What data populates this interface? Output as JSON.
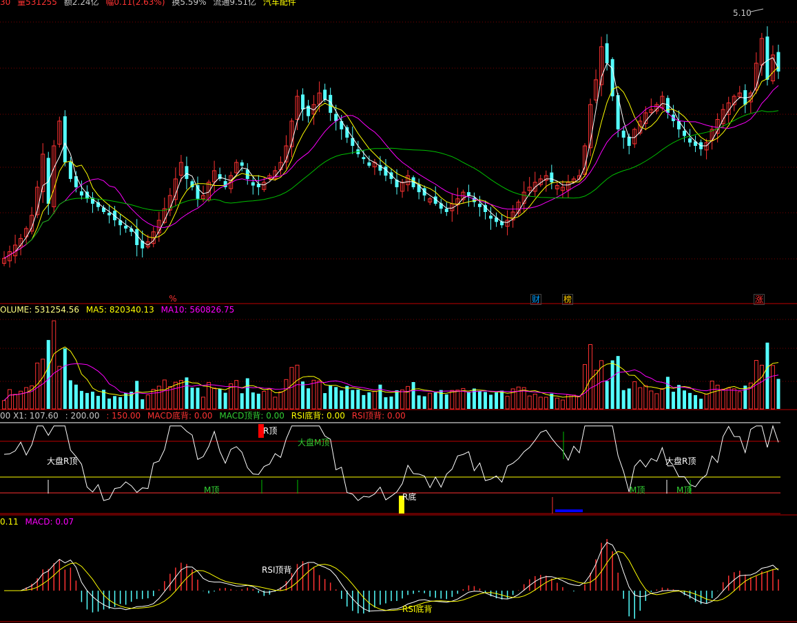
{
  "header": {
    "items": [
      {
        "text": "30",
        "color": "#ff3232"
      },
      {
        "text": "量531255",
        "color": "#ff3232"
      },
      {
        "text": "额2.24亿",
        "color": "#c8c8c8"
      },
      {
        "text": "幅0.11(2.63%)",
        "color": "#ff3232"
      },
      {
        "text": "换5.59%",
        "color": "#c8c8c8"
      },
      {
        "text": "流通9.51亿",
        "color": "#c8c8c8"
      },
      {
        "text": "汽车配件",
        "color": "#ffff00"
      }
    ]
  },
  "price_panel": {
    "high_label": "5.10",
    "events": [
      {
        "text": "%",
        "color": "#ff3232",
        "border": "#000"
      },
      {
        "text": "财",
        "color": "#00a0ff",
        "border": "#444"
      },
      {
        "text": "榜",
        "color": "#ffcc00",
        "border": "#444"
      },
      {
        "text": "涨",
        "color": "#ff3232",
        "border": "#444"
      }
    ]
  },
  "volume_panel": {
    "label_volume": "OLUME: 531254.56",
    "label_ma5": "MA5: 820340.13",
    "label_ma10": "MA10: 560826.75"
  },
  "signal_panel": {
    "label_x": "00  X1: 107.60",
    "label_200": ": 200.00",
    "label_150": ": 150.00",
    "label_macd_bottom": "MACD底背: 0.00",
    "label_macd_top": "MACD顶背: 0.00",
    "label_rsi_bottom": "RSI底背: 0.00",
    "label_rsi_top": "RSI顶背: 0.00",
    "marks": [
      {
        "text": "R顶",
        "color": "#ffffff"
      },
      {
        "text": "大盘M顶",
        "color": "#32cd32"
      },
      {
        "text": "大盘R顶",
        "color": "#ffffff"
      },
      {
        "text": "大盘R顶",
        "color": "#ffffff"
      },
      {
        "text": "M顶",
        "color": "#32cd32"
      },
      {
        "text": "M顶",
        "color": "#32cd32"
      },
      {
        "text": "M顶",
        "color": "#32cd32"
      },
      {
        "text": "R底",
        "color": "#ffffff"
      }
    ]
  },
  "macd_panel": {
    "label_dif": "0.11",
    "label_macd": "MACD: 0.07",
    "mark_top": "RSI顶背",
    "mark_bottom": "RSI底背"
  },
  "colors": {
    "up": "#ff3232",
    "down": "#54ffff",
    "ma_white": "#ffffff",
    "ma_yellow": "#ffff00",
    "ma_magenta": "#ff00ff",
    "ma_green": "#00c000",
    "grid": "#800000",
    "separator": "#c00000"
  },
  "chart_data": {
    "type": "candlestick",
    "closes": [
      3.62,
      3.66,
      3.7,
      3.74,
      3.8,
      3.88,
      4.05,
      4.25,
      3.95,
      4.3,
      4.45,
      4.2,
      4.1,
      4.05,
      4.0,
      3.98,
      3.95,
      3.93,
      3.9,
      3.88,
      3.85,
      3.82,
      3.8,
      3.78,
      3.7,
      3.68,
      3.72,
      3.78,
      3.85,
      3.92,
      4.0,
      4.1,
      4.2,
      4.1,
      4.05,
      3.98,
      4.0,
      4.08,
      4.15,
      4.1,
      4.05,
      4.12,
      4.2,
      4.18,
      4.1,
      4.06,
      4.05,
      4.08,
      4.12,
      4.15,
      4.2,
      4.3,
      4.45,
      4.6,
      4.52,
      4.48,
      4.55,
      4.62,
      4.58,
      4.5,
      4.45,
      4.4,
      4.35,
      4.3,
      4.25,
      4.22,
      4.18,
      4.2,
      4.15,
      4.12,
      4.1,
      4.05,
      4.08,
      4.12,
      4.05,
      4.02,
      4.0,
      3.98,
      3.95,
      3.92,
      3.9,
      3.95,
      3.98,
      4.02,
      4.0,
      3.96,
      3.93,
      3.9,
      3.86,
      3.84,
      3.82,
      3.85,
      3.9,
      3.96,
      4.02,
      4.05,
      4.08,
      4.1,
      4.12,
      4.08,
      4.06,
      4.05,
      4.08,
      4.1,
      4.12,
      4.3,
      4.55,
      4.7,
      4.9,
      4.8,
      4.6,
      4.4,
      4.35,
      4.3,
      4.4,
      4.45,
      4.5,
      4.52,
      4.55,
      4.6,
      4.5,
      4.45,
      4.4,
      4.36,
      4.32,
      4.3,
      4.28,
      4.32,
      4.4,
      4.46,
      4.52,
      4.56,
      4.6,
      4.62,
      4.55,
      4.62,
      4.8,
      4.95,
      4.7,
      4.85,
      4.75
    ],
    "volume_ma_labels": [
      "VOLUME",
      "MA5",
      "MA10"
    ]
  }
}
